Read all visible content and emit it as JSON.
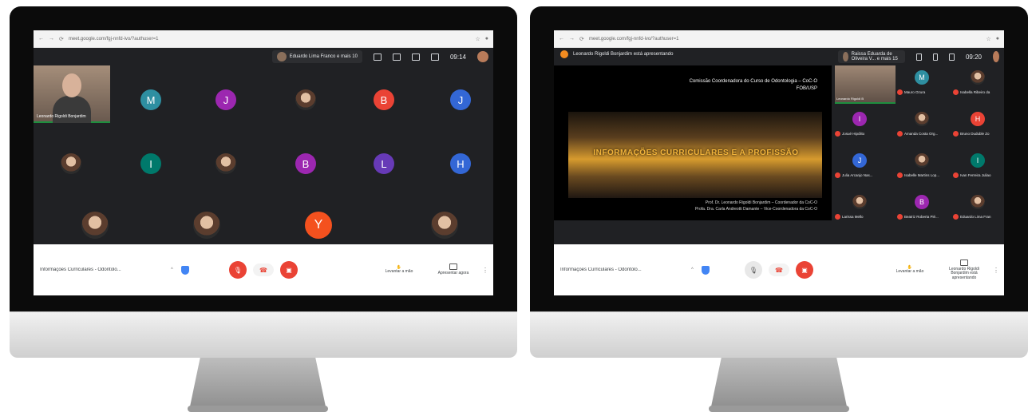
{
  "left": {
    "url": "meet.google.com/fgj-nnfd-ivo/?authuser=1",
    "participants_pill": "Eduardo Lima Franco e mais 10",
    "time": "09:14",
    "self_label": "Leonardo Rigoldi Bonjardim",
    "tiles": [
      {
        "letter": "M",
        "color": "#2e8fa1"
      },
      {
        "letter": "J",
        "color": "#9c27b0"
      },
      {
        "letter": "",
        "color": "photo"
      },
      {
        "letter": "B",
        "color": "#ea4335"
      },
      {
        "letter": "J",
        "color": "#3367d6"
      },
      {
        "letter": "",
        "color": "photo"
      },
      {
        "letter": "I",
        "color": "#00796b"
      },
      {
        "letter": "",
        "color": "photo"
      },
      {
        "letter": "B",
        "color": "#9c27b0"
      },
      {
        "letter": "L",
        "color": "#673ab7"
      },
      {
        "letter": "H",
        "color": "#3367d6"
      },
      {
        "letter": "",
        "color": "photo"
      },
      {
        "letter": "",
        "color": "photo"
      },
      {
        "letter": "Y",
        "color": "#f4511e"
      },
      {
        "letter": "",
        "color": "photo"
      }
    ],
    "meeting_name": "Informações Curriculares - Odontolo...",
    "raise_hand": "Levantar a mão",
    "present_now": "Apresentar agora"
  },
  "right": {
    "url": "meet.google.com/fgj-nnfd-ivo/?authuser=1",
    "presenting_banner": "Leonardo Rigoldi Bonjardim está apresentando",
    "participants_pill": "Raissa Eduarda de Oliveira V... e mais 15",
    "time": "09:20",
    "slide": {
      "org_line1": "Comissão Coordenadora do Curso de Odontologia – CoC-O",
      "org_line2": "FOB/USP",
      "title": "INFORMAÇÕES CURRICULARES E A PROFISSÃO",
      "credit1": "Prof. Dr. Leonardo Rigoldi Bonjardim – Coordenador da CoC-O",
      "credit2": "Profa. Dra. Carla Andreotti Damante – Vice-Coordenadora da CoC-O"
    },
    "self_label": "Leonardo Rigoldi B",
    "side_tiles": [
      {
        "letter": "M",
        "color": "#2e8fa1",
        "name": "Mauro Ozura"
      },
      {
        "letter": "",
        "color": "photo",
        "name": "Isabella Ribeiro da"
      },
      {
        "letter": "I",
        "color": "#9c27b0",
        "name": "Josué Hipólito"
      },
      {
        "letter": "",
        "color": "photo",
        "name": "Amanda Costa Org..."
      },
      {
        "letter": "H",
        "color": "#ea4335",
        "name": "Bruno Duduble Zo"
      },
      {
        "letter": "J",
        "color": "#3367d6",
        "name": "Julia Arcanjo Nas..."
      },
      {
        "letter": "",
        "color": "photo",
        "name": "Isabelle Martins Lop..."
      },
      {
        "letter": "I",
        "color": "#00796b",
        "name": "Ivan Ferreira Juliao"
      },
      {
        "letter": "",
        "color": "photo",
        "name": "Larissa Mello"
      },
      {
        "letter": "B",
        "color": "#9c27b0",
        "name": "Beatriz Roberta Pié..."
      },
      {
        "letter": "",
        "color": "photo",
        "name": "Eduardo Lima Fran"
      }
    ],
    "meeting_name": "Informações Curriculares - Odontolo...",
    "raise_hand": "Levantar a mão",
    "presenting_label": "Leonardo Rigoldi Bonjardim está apresentando"
  }
}
